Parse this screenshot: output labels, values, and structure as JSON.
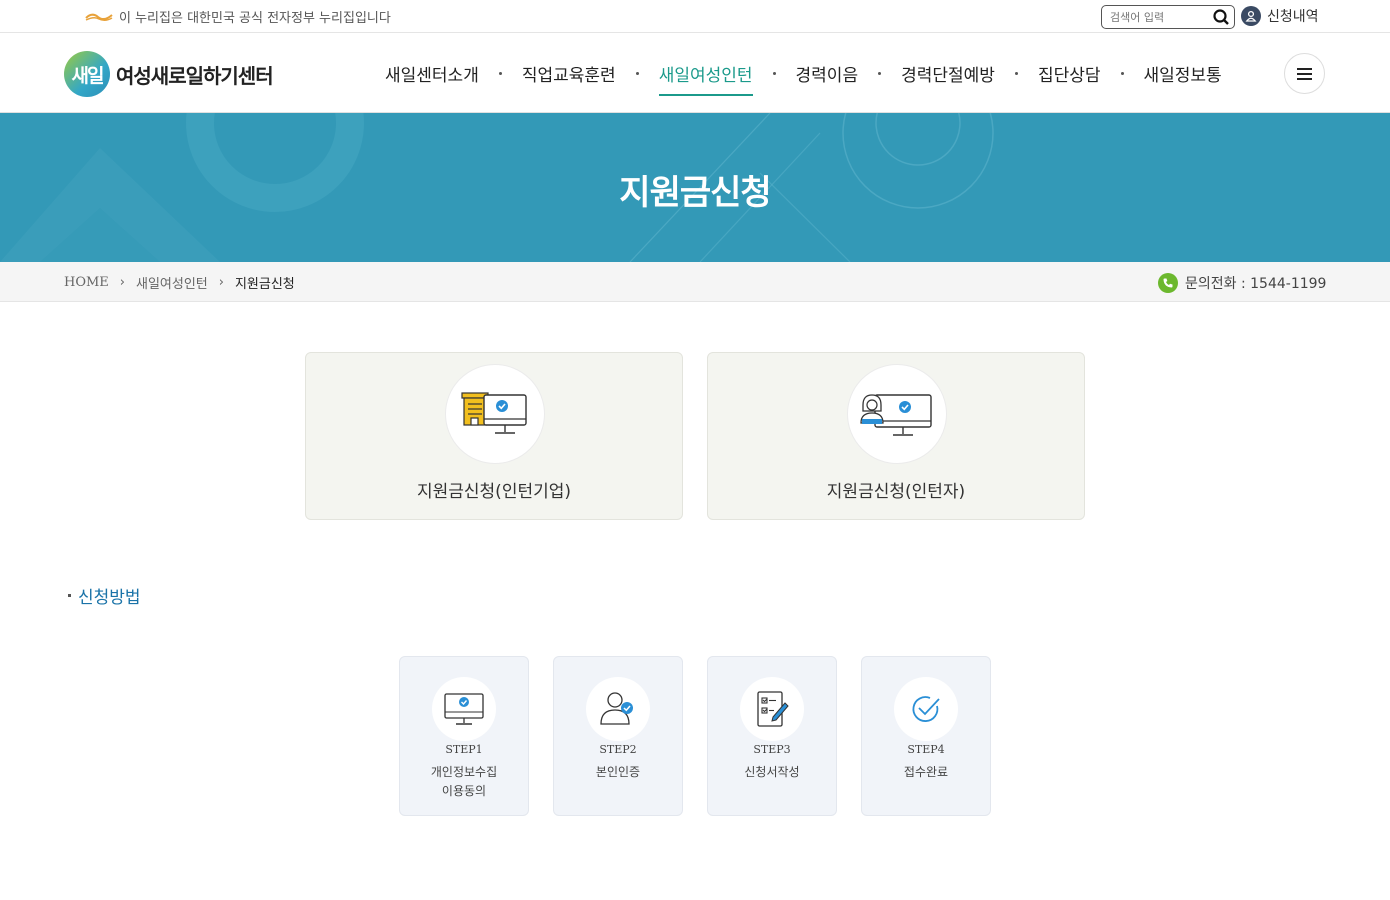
{
  "util": {
    "gov_notice": "이 누리집은 대한민국 공식 전자정부 누리집입니다",
    "search_placeholder": "검색어 입력",
    "apply_history": "신청내역"
  },
  "header": {
    "logo_mark": "새일",
    "logo_text": "여성새로일하기센터",
    "nav": [
      {
        "label": "새일센터소개"
      },
      {
        "label": "직업교육훈련"
      },
      {
        "label": "새일여성인턴",
        "active": true
      },
      {
        "label": "경력이음"
      },
      {
        "label": "경력단절예방"
      },
      {
        "label": "집단상담"
      },
      {
        "label": "새일정보통"
      }
    ],
    "accent_color": "#1b9a8b"
  },
  "banner": {
    "title": "지원금신청",
    "color": "#3399b7"
  },
  "breadcrumb": {
    "items": [
      "HOME",
      "새일여성인턴",
      "지원금신청"
    ],
    "separator": "›"
  },
  "contact": {
    "label": "문의전화 : 1544-1199"
  },
  "cards": [
    {
      "label": "지원금신청(인턴기업)",
      "icon": "company-computer-icon"
    },
    {
      "label": "지원금신청(인턴자)",
      "icon": "person-computer-icon"
    }
  ],
  "section": {
    "title": "신청방법"
  },
  "steps": [
    {
      "num": "STEP1",
      "text": "개인정보수집 이용동의",
      "icon": "monitor-check-icon"
    },
    {
      "num": "STEP2",
      "text": "본인인증",
      "icon": "user-check-icon"
    },
    {
      "num": "STEP3",
      "text": "신청서작성",
      "icon": "form-pen-icon"
    },
    {
      "num": "STEP4",
      "text": "접수완료",
      "icon": "check-circle-icon"
    }
  ]
}
